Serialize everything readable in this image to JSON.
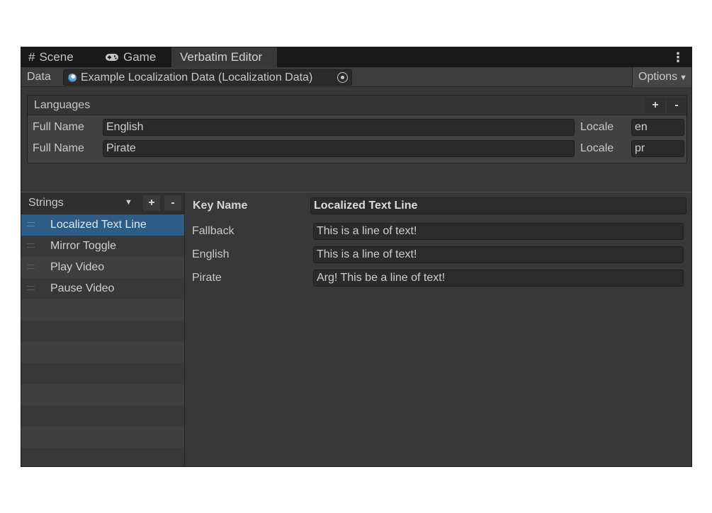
{
  "tabs": [
    {
      "label": "Scene",
      "icon": "#"
    },
    {
      "label": "Game",
      "icon": "Ṕ"
    },
    {
      "label": "Verbatim Editor",
      "icon": ""
    }
  ],
  "tab_menu": "⋮",
  "data_row": {
    "label": "Data",
    "asset": "Example Localization Data (Localization Data)",
    "options_label": "Options",
    "options_caret": "▼"
  },
  "languages": {
    "title": "Languages",
    "add": "+",
    "remove": "-",
    "full_name_label": "Full Name",
    "locale_label": "Locale",
    "rows": [
      {
        "full_name": "English",
        "locale": "en"
      },
      {
        "full_name": "Pirate",
        "locale": "pr"
      }
    ]
  },
  "strings": {
    "title": "Strings",
    "caret": "▼",
    "add": "+",
    "remove": "-",
    "items": [
      "Localized Text Line",
      "Mirror Toggle",
      "Play Video",
      "Pause Video"
    ],
    "selected_index": 0
  },
  "detail": {
    "key_name_label": "Key Name",
    "key_name_value": "Localized Text Line",
    "translations": [
      {
        "label": "Fallback",
        "value": "This is a line of text!"
      },
      {
        "label": "English",
        "value": "This is a line of text!"
      },
      {
        "label": "Pirate",
        "value": "Arg! This be a line of text!"
      }
    ]
  },
  "colors": {
    "selection": "#2c5d87",
    "window_bg": "#383838",
    "tab_bar": "#191919"
  }
}
